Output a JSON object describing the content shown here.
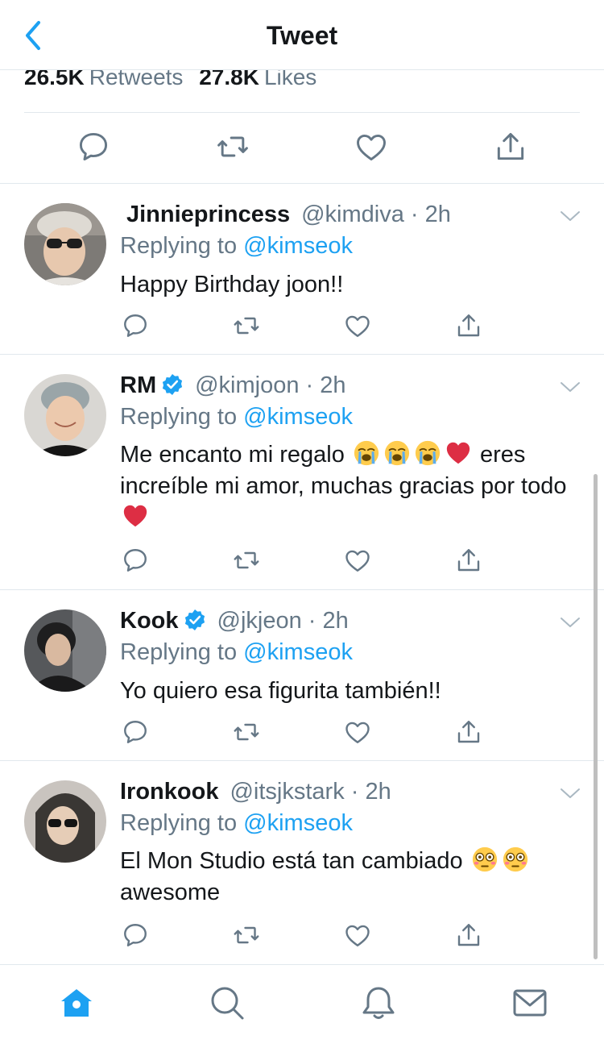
{
  "header": {
    "title": "Tweet",
    "back_icon": "chevron-left-icon"
  },
  "stats": {
    "retweets_count": "26.5K",
    "retweets_label": "Retweets",
    "likes_count": "27.8K",
    "likes_label": "Likes"
  },
  "actions": [
    "reply-icon",
    "retweet-icon",
    "like-icon",
    "share-icon"
  ],
  "replies": [
    {
      "name": "Jinnieprincess",
      "handle": "@kimdiva",
      "time": "· 2h",
      "verified": false,
      "replying_prefix": "Replying to",
      "mention": "@kimseok",
      "text": "Happy Birthday joon!!"
    },
    {
      "name": "RM",
      "handle": "@kimjoon",
      "time": "· 2h",
      "verified": true,
      "replying_prefix": "Replying to",
      "mention": "@kimseok",
      "text_a": "Me encanto mi regalo",
      "text_b": "eres increíble mi amor, muchas gracias por todo",
      "emojis": [
        "loudly-crying-face",
        "loudly-crying-face",
        "loudly-crying-face",
        "red-heart",
        "red-heart"
      ]
    },
    {
      "name": "Kook",
      "handle": "@jkjeon",
      "time": "· 2h",
      "verified": true,
      "replying_prefix": "Replying to",
      "mention": "@kimseok",
      "text": "Yo quiero esa figurita también!!"
    },
    {
      "name": "Ironkook",
      "handle": "@itsjkstark",
      "time": "· 2h",
      "verified": false,
      "replying_prefix": "Replying to",
      "mention": "@kimseok",
      "text_a": "El Mon Studio está tan cambiado",
      "text_b": "awesome",
      "emojis": [
        "flushed-face",
        "flushed-face"
      ]
    }
  ],
  "tabbar": [
    "home-icon",
    "search-icon",
    "notifications-bell-icon",
    "messages-envelope-icon"
  ],
  "colors": {
    "accent": "#1da1f2",
    "muted": "#657786",
    "text": "#14171a",
    "divider": "#e1e8ed"
  }
}
